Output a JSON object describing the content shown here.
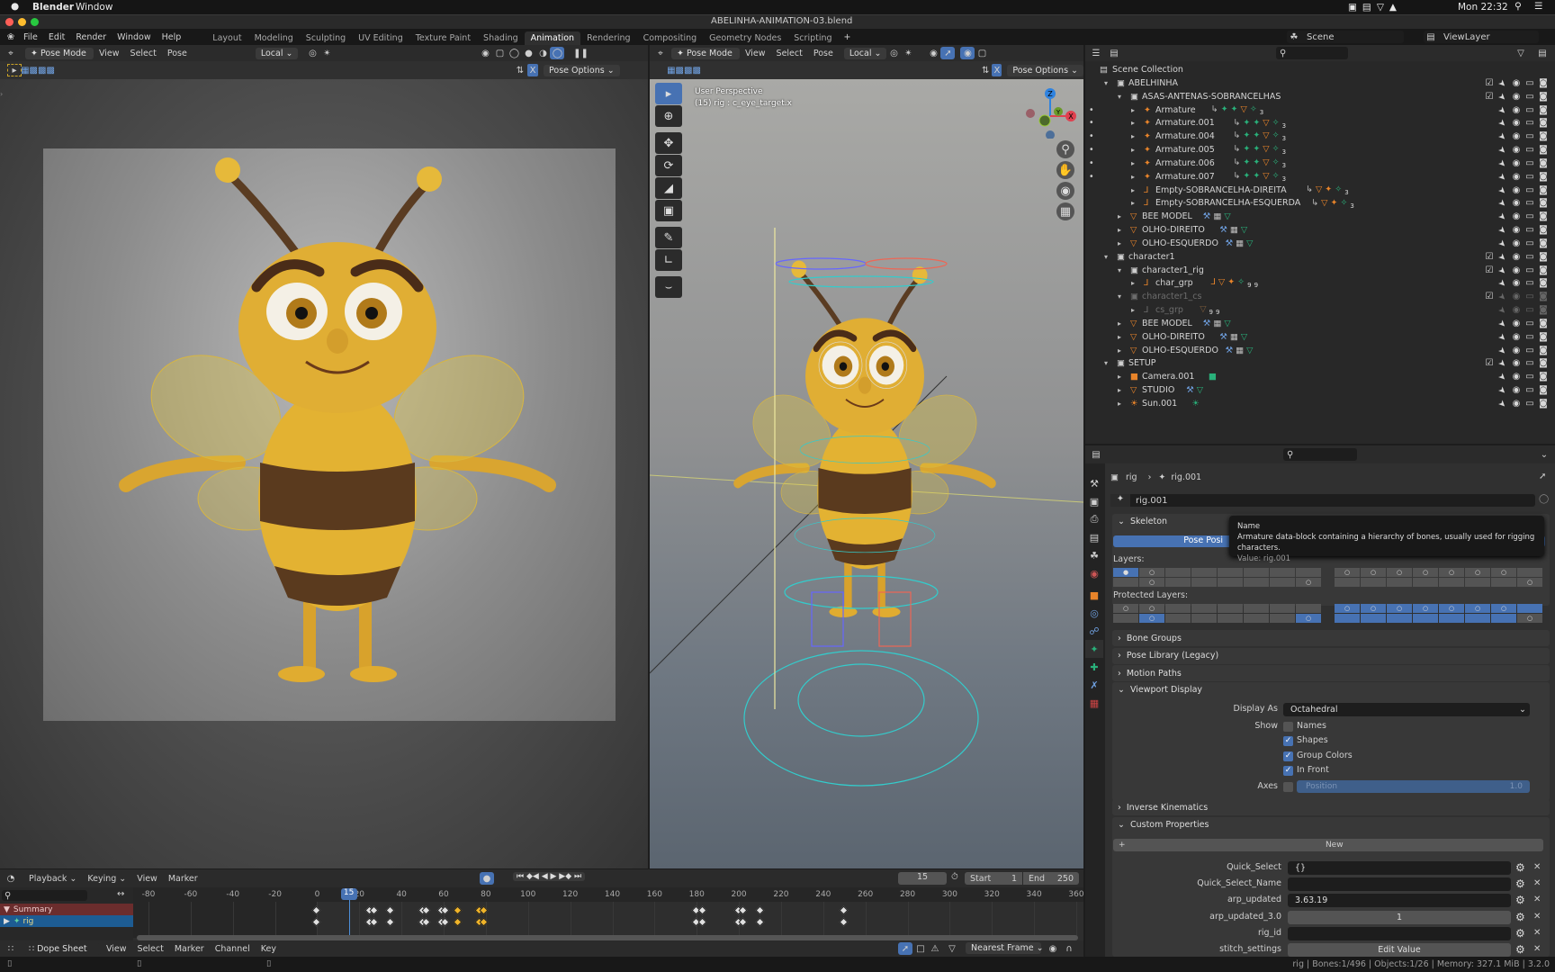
{
  "mac_menu": {
    "app": "Blender",
    "items": [
      "Window"
    ],
    "clock": "Mon 22:32"
  },
  "window_title": "ABELINHA-ANIMATION-03.blend",
  "topbar": {
    "menus": [
      "File",
      "Edit",
      "Render",
      "Window",
      "Help"
    ],
    "workspaces": [
      "Layout",
      "Modeling",
      "Sculpting",
      "UV Editing",
      "Texture Paint",
      "Shading",
      "Animation",
      "Rendering",
      "Compositing",
      "Geometry Nodes",
      "Scripting"
    ],
    "active_workspace": "Animation",
    "scene": "Scene",
    "view_layer": "ViewLayer"
  },
  "viewport_left": {
    "mode": "Pose Mode",
    "menus": [
      "View",
      "Select",
      "Pose"
    ],
    "orientation": "Local",
    "pose_options": "Pose Options",
    "x_label": "X"
  },
  "viewport_right": {
    "mode": "Pose Mode",
    "menus": [
      "View",
      "Select",
      "Pose"
    ],
    "orientation": "Local",
    "pose_options": "Pose Options",
    "x_label": "X",
    "overlay_title": "User Perspective",
    "overlay_sub": "(15) rig : c_eye_target.x",
    "gizmo": {
      "z": "Z",
      "y": "Y",
      "x": "X"
    }
  },
  "outliner": {
    "root": "Scene Collection",
    "rows": [
      {
        "name": "ABELHINHA",
        "depth": 0,
        "type": "collection",
        "open": true,
        "check": true,
        "extras": []
      },
      {
        "name": "ASAS-ANTENAS-SOBRANCELHAS",
        "depth": 1,
        "type": "collection",
        "open": true,
        "check": true,
        "extras": []
      },
      {
        "name": "Armature",
        "depth": 2,
        "type": "armature",
        "dot": true,
        "extras": [
          "constraint",
          "pose",
          "armdata",
          "mesh",
          "bone"
        ],
        "badge": "3"
      },
      {
        "name": "Armature.001",
        "depth": 2,
        "type": "armature",
        "dot": true,
        "extras": [
          "constraint",
          "pose",
          "armdata",
          "mesh",
          "bone"
        ],
        "badge": "3"
      },
      {
        "name": "Armature.004",
        "depth": 2,
        "type": "armature",
        "dot": true,
        "extras": [
          "constraint",
          "pose",
          "armdata",
          "mesh",
          "bone"
        ],
        "badge": "3"
      },
      {
        "name": "Armature.005",
        "depth": 2,
        "type": "armature",
        "dot": true,
        "extras": [
          "constraint",
          "pose",
          "armdata",
          "mesh",
          "bone"
        ],
        "badge": "3"
      },
      {
        "name": "Armature.006",
        "depth": 2,
        "type": "armature",
        "dot": true,
        "extras": [
          "constraint",
          "pose",
          "armdata",
          "mesh",
          "bone"
        ],
        "badge": "3"
      },
      {
        "name": "Armature.007",
        "depth": 2,
        "type": "armature",
        "dot": true,
        "extras": [
          "constraint",
          "pose",
          "armdata",
          "mesh",
          "bone"
        ],
        "badge": "3"
      },
      {
        "name": "Empty-SOBRANCELHA-DIREITA",
        "depth": 2,
        "type": "empty",
        "extras": [
          "constraint",
          "mesh",
          "armature",
          "bone"
        ],
        "badge": "3"
      },
      {
        "name": "Empty-SOBRANCELHA-ESQUERDA",
        "depth": 2,
        "type": "empty",
        "extras": [
          "constraint",
          "mesh",
          "armature",
          "bone"
        ],
        "badge": "3"
      },
      {
        "name": "BEE MODEL",
        "depth": 1,
        "type": "mesh",
        "extras": [
          "modifier",
          "material",
          "meshdata"
        ]
      },
      {
        "name": "OLHO-DIREITO",
        "depth": 1,
        "type": "mesh",
        "extras": [
          "modifier",
          "material",
          "meshdata"
        ]
      },
      {
        "name": "OLHO-ESQUERDO",
        "depth": 1,
        "type": "mesh",
        "extras": [
          "modifier",
          "material",
          "meshdata"
        ]
      },
      {
        "name": "character1",
        "depth": 0,
        "type": "collection",
        "open": true,
        "check": true,
        "extras": []
      },
      {
        "name": "character1_rig",
        "depth": 1,
        "type": "collection",
        "open": true,
        "check": true,
        "extras": []
      },
      {
        "name": "char_grp",
        "depth": 2,
        "type": "empty",
        "extras": [
          "empty",
          "mesh",
          "armature",
          "bone"
        ],
        "badge": "99"
      },
      {
        "name": "character1_cs",
        "depth": 1,
        "type": "collection",
        "open": true,
        "check": true,
        "dim": true,
        "extras": []
      },
      {
        "name": "cs_grp",
        "depth": 2,
        "type": "empty",
        "dim": true,
        "extras": [
          "mesh"
        ],
        "badge": "99"
      },
      {
        "name": "BEE MODEL",
        "depth": 1,
        "type": "mesh",
        "extras": [
          "modifier",
          "material",
          "meshdata"
        ]
      },
      {
        "name": "OLHO-DIREITO",
        "depth": 1,
        "type": "mesh",
        "extras": [
          "modifier",
          "material",
          "meshdata"
        ]
      },
      {
        "name": "OLHO-ESQUERDO",
        "depth": 1,
        "type": "mesh",
        "extras": [
          "modifier",
          "material",
          "meshdata"
        ]
      },
      {
        "name": "SETUP",
        "depth": 0,
        "type": "collection",
        "open": true,
        "check": true,
        "extras": []
      },
      {
        "name": "Camera.001",
        "depth": 1,
        "type": "camera",
        "extras": [
          "cameradata"
        ]
      },
      {
        "name": "STUDIO",
        "depth": 1,
        "type": "mesh",
        "extras": [
          "modifier",
          "meshdata"
        ]
      },
      {
        "name": "Sun.001",
        "depth": 1,
        "type": "light",
        "extras": [
          "sun"
        ]
      }
    ]
  },
  "properties": {
    "breadcrumb": [
      "rig",
      "rig.001"
    ],
    "datablock_name": "rig.001",
    "skeleton": {
      "title": "Skeleton",
      "pose_position": "Pose Posi",
      "layers_label": "Layers:",
      "protected_label": "Protected Layers:"
    },
    "layers": {
      "active": [
        0
      ],
      "dots": [
        1,
        17,
        8,
        9,
        10,
        11,
        12,
        13,
        14,
        31,
        23
      ]
    },
    "protected_layers": {
      "on": [
        17,
        23,
        8,
        9,
        10,
        11,
        12,
        13,
        14,
        15,
        24,
        25,
        26,
        27,
        28,
        29,
        30
      ],
      "dots": [
        0,
        1,
        17,
        23,
        8,
        9,
        10,
        11,
        12,
        13,
        14,
        31
      ]
    },
    "tooltip": {
      "title": "Name",
      "body": "Armature data-block containing a hierarchy of bones, usually used for rigging characters.",
      "value": "Value: rig.001"
    },
    "collapsed_panels": [
      "Bone Groups",
      "Pose Library (Legacy)",
      "Motion Paths"
    ],
    "viewport_display": {
      "title": "Viewport Display",
      "display_as_label": "Display As",
      "display_as": "Octahedral",
      "show_label": "Show",
      "show": [
        {
          "label": "Names",
          "on": false
        },
        {
          "label": "Shapes",
          "on": true
        },
        {
          "label": "Group Colors",
          "on": true
        },
        {
          "label": "In Front",
          "on": true
        }
      ],
      "axes_label": "Axes",
      "axes_position_label": "Position",
      "axes_position_value": "1.0"
    },
    "ik_title": "Inverse Kinematics",
    "custom_properties": {
      "title": "Custom Properties",
      "new_label": "New",
      "items": [
        {
          "name": "Quick_Select",
          "value": "{}",
          "kind": "text"
        },
        {
          "name": "Quick_Select_Name",
          "value": "",
          "kind": "text"
        },
        {
          "name": "arp_updated",
          "value": "3.63.19",
          "kind": "text"
        },
        {
          "name": "arp_updated_3.0",
          "value": "1",
          "kind": "number"
        },
        {
          "name": "rig_id",
          "value": "",
          "kind": "text"
        },
        {
          "name": "stitch_settings",
          "value": "Edit Value",
          "kind": "button"
        }
      ]
    }
  },
  "timeline": {
    "menus": [
      "Playback",
      "Keying",
      "View",
      "Marker"
    ],
    "current_frame": "15",
    "start_label": "Start",
    "start": "1",
    "end_label": "End",
    "end": "250",
    "ruler": [
      "-80",
      "-60",
      "-40",
      "-20",
      "0",
      "20",
      "40",
      "60",
      "80",
      "100",
      "120",
      "140",
      "160",
      "180",
      "200",
      "220",
      "240",
      "260",
      "280",
      "300",
      "320",
      "340",
      "360"
    ],
    "frame_range": [
      -80,
      360
    ],
    "channels": [
      "Summary",
      "rig"
    ],
    "keyframes": [
      0,
      25,
      27,
      35,
      50,
      52,
      59,
      61,
      67,
      77,
      79,
      180,
      183,
      200,
      202,
      210,
      250
    ],
    "selected_keyframes": [
      67,
      77,
      79
    ]
  },
  "dopesheet": {
    "mode": "Dope Sheet",
    "menus": [
      "View",
      "Select",
      "Marker",
      "Channel",
      "Key"
    ],
    "snap": "Nearest Frame"
  },
  "statusbar": "rig | Bones:1/496 | Objects:1/26 | Memory: 327.1 MiB | 3.2.0"
}
